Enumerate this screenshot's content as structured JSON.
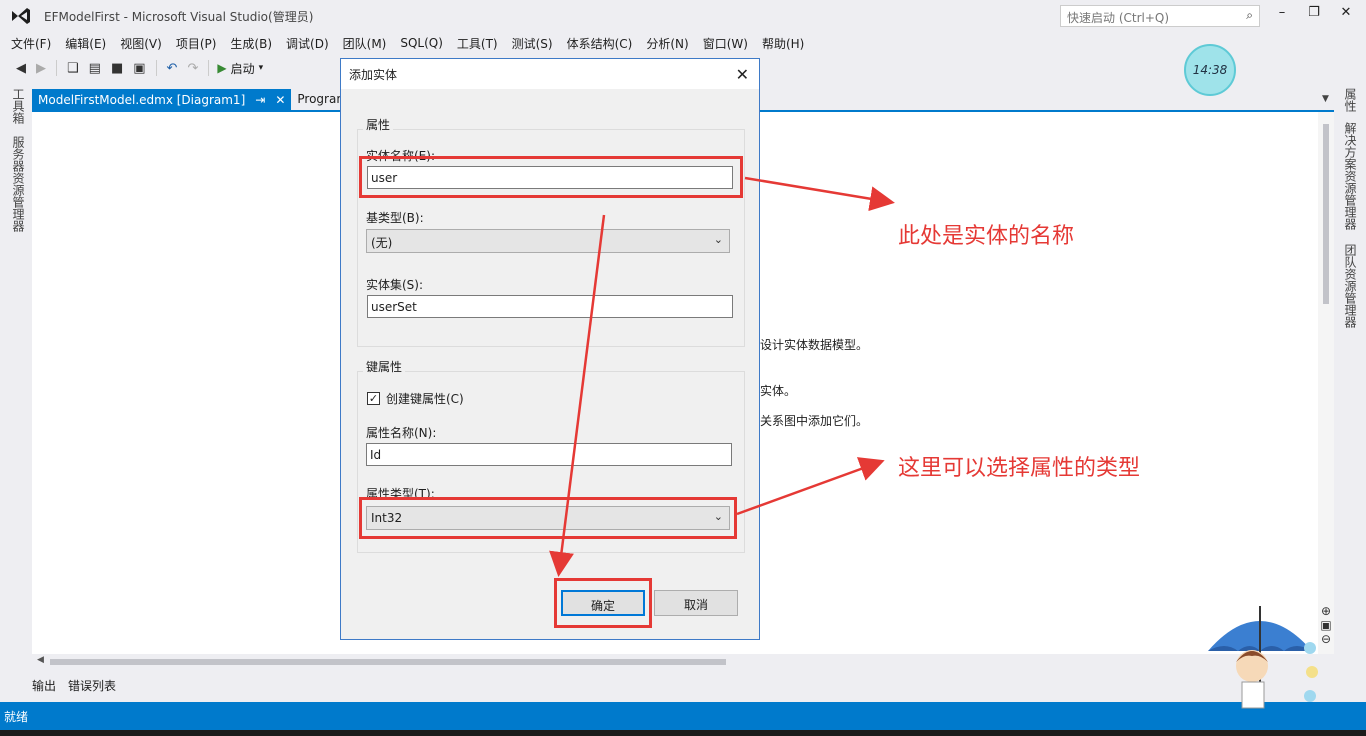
{
  "window": {
    "title": "EFModelFirst - Microsoft Visual Studio(管理员)",
    "quick_launch_placeholder": "快速启动 (Ctrl+Q)"
  },
  "menu": [
    "文件(F)",
    "编辑(E)",
    "视图(V)",
    "项目(P)",
    "生成(B)",
    "调试(D)",
    "团队(M)",
    "SQL(Q)",
    "工具(T)",
    "测试(S)",
    "体系结构(C)",
    "分析(N)",
    "窗口(W)",
    "帮助(H)"
  ],
  "toolbar": {
    "start_label": "启动"
  },
  "clock": {
    "time": "14:38"
  },
  "left_tool_tabs": [
    "工具箱",
    "服务器资源管理器"
  ],
  "right_tool_tabs": [
    "属性",
    "解决方案资源管理器",
    "团队资源管理器"
  ],
  "doc_tabs": {
    "active": "ModelFirstModel.edmx [Diagram1]",
    "inactive": "Program"
  },
  "designer_text": [
    "设计实体数据模型。",
    "实体。",
    "关系图中添加它们。"
  ],
  "bottom_tabs": [
    "输出",
    "错误列表"
  ],
  "status": {
    "text": "就绪"
  },
  "dialog": {
    "title": "添加实体",
    "properties_group": "属性",
    "entity_name_label": "实体名称(E):",
    "entity_name_value": "user",
    "base_type_label": "基类型(B):",
    "base_type_value": "(无)",
    "entity_set_label": "实体集(S):",
    "entity_set_value": "userSet",
    "key_group": "键属性",
    "create_key_label": "创建键属性(C)",
    "create_key_checked": true,
    "property_name_label": "属性名称(N):",
    "property_name_value": "Id",
    "property_type_label": "属性类型(T):",
    "property_type_value": "Int32",
    "ok_label": "确定",
    "cancel_label": "取消"
  },
  "annotations": {
    "note_entity_name": "此处是实体的名称",
    "note_property_type": "这里可以选择属性的类型",
    "color": "#e53935"
  },
  "colors": {
    "accent": "#007acc"
  }
}
